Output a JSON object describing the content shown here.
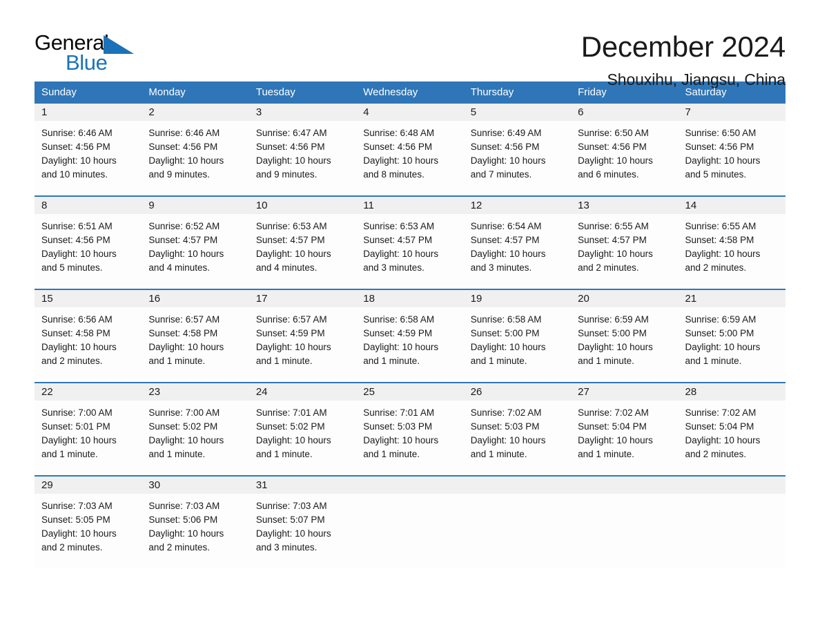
{
  "logo": {
    "word_one": "General",
    "word_two": "Blue",
    "triangle_icon": "triangle-icon",
    "accent_color": "#1b72b8"
  },
  "header": {
    "title": "December 2024",
    "subtitle": "Shouxihu, Jiangsu, China"
  },
  "calendar": {
    "header_bg_color": "#2f76b8",
    "date_band_color": "#f0f0f0",
    "weekdays": [
      "Sunday",
      "Monday",
      "Tuesday",
      "Wednesday",
      "Thursday",
      "Friday",
      "Saturday"
    ],
    "weeks": [
      [
        {
          "date": "1",
          "sunrise": "Sunrise: 6:46 AM",
          "sunset": "Sunset: 4:56 PM",
          "daylight_line1": "Daylight: 10 hours",
          "daylight_line2": "and 10 minutes."
        },
        {
          "date": "2",
          "sunrise": "Sunrise: 6:46 AM",
          "sunset": "Sunset: 4:56 PM",
          "daylight_line1": "Daylight: 10 hours",
          "daylight_line2": "and 9 minutes."
        },
        {
          "date": "3",
          "sunrise": "Sunrise: 6:47 AM",
          "sunset": "Sunset: 4:56 PM",
          "daylight_line1": "Daylight: 10 hours",
          "daylight_line2": "and 9 minutes."
        },
        {
          "date": "4",
          "sunrise": "Sunrise: 6:48 AM",
          "sunset": "Sunset: 4:56 PM",
          "daylight_line1": "Daylight: 10 hours",
          "daylight_line2": "and 8 minutes."
        },
        {
          "date": "5",
          "sunrise": "Sunrise: 6:49 AM",
          "sunset": "Sunset: 4:56 PM",
          "daylight_line1": "Daylight: 10 hours",
          "daylight_line2": "and 7 minutes."
        },
        {
          "date": "6",
          "sunrise": "Sunrise: 6:50 AM",
          "sunset": "Sunset: 4:56 PM",
          "daylight_line1": "Daylight: 10 hours",
          "daylight_line2": "and 6 minutes."
        },
        {
          "date": "7",
          "sunrise": "Sunrise: 6:50 AM",
          "sunset": "Sunset: 4:56 PM",
          "daylight_line1": "Daylight: 10 hours",
          "daylight_line2": "and 5 minutes."
        }
      ],
      [
        {
          "date": "8",
          "sunrise": "Sunrise: 6:51 AM",
          "sunset": "Sunset: 4:56 PM",
          "daylight_line1": "Daylight: 10 hours",
          "daylight_line2": "and 5 minutes."
        },
        {
          "date": "9",
          "sunrise": "Sunrise: 6:52 AM",
          "sunset": "Sunset: 4:57 PM",
          "daylight_line1": "Daylight: 10 hours",
          "daylight_line2": "and 4 minutes."
        },
        {
          "date": "10",
          "sunrise": "Sunrise: 6:53 AM",
          "sunset": "Sunset: 4:57 PM",
          "daylight_line1": "Daylight: 10 hours",
          "daylight_line2": "and 4 minutes."
        },
        {
          "date": "11",
          "sunrise": "Sunrise: 6:53 AM",
          "sunset": "Sunset: 4:57 PM",
          "daylight_line1": "Daylight: 10 hours",
          "daylight_line2": "and 3 minutes."
        },
        {
          "date": "12",
          "sunrise": "Sunrise: 6:54 AM",
          "sunset": "Sunset: 4:57 PM",
          "daylight_line1": "Daylight: 10 hours",
          "daylight_line2": "and 3 minutes."
        },
        {
          "date": "13",
          "sunrise": "Sunrise: 6:55 AM",
          "sunset": "Sunset: 4:57 PM",
          "daylight_line1": "Daylight: 10 hours",
          "daylight_line2": "and 2 minutes."
        },
        {
          "date": "14",
          "sunrise": "Sunrise: 6:55 AM",
          "sunset": "Sunset: 4:58 PM",
          "daylight_line1": "Daylight: 10 hours",
          "daylight_line2": "and 2 minutes."
        }
      ],
      [
        {
          "date": "15",
          "sunrise": "Sunrise: 6:56 AM",
          "sunset": "Sunset: 4:58 PM",
          "daylight_line1": "Daylight: 10 hours",
          "daylight_line2": "and 2 minutes."
        },
        {
          "date": "16",
          "sunrise": "Sunrise: 6:57 AM",
          "sunset": "Sunset: 4:58 PM",
          "daylight_line1": "Daylight: 10 hours",
          "daylight_line2": "and 1 minute."
        },
        {
          "date": "17",
          "sunrise": "Sunrise: 6:57 AM",
          "sunset": "Sunset: 4:59 PM",
          "daylight_line1": "Daylight: 10 hours",
          "daylight_line2": "and 1 minute."
        },
        {
          "date": "18",
          "sunrise": "Sunrise: 6:58 AM",
          "sunset": "Sunset: 4:59 PM",
          "daylight_line1": "Daylight: 10 hours",
          "daylight_line2": "and 1 minute."
        },
        {
          "date": "19",
          "sunrise": "Sunrise: 6:58 AM",
          "sunset": "Sunset: 5:00 PM",
          "daylight_line1": "Daylight: 10 hours",
          "daylight_line2": "and 1 minute."
        },
        {
          "date": "20",
          "sunrise": "Sunrise: 6:59 AM",
          "sunset": "Sunset: 5:00 PM",
          "daylight_line1": "Daylight: 10 hours",
          "daylight_line2": "and 1 minute."
        },
        {
          "date": "21",
          "sunrise": "Sunrise: 6:59 AM",
          "sunset": "Sunset: 5:00 PM",
          "daylight_line1": "Daylight: 10 hours",
          "daylight_line2": "and 1 minute."
        }
      ],
      [
        {
          "date": "22",
          "sunrise": "Sunrise: 7:00 AM",
          "sunset": "Sunset: 5:01 PM",
          "daylight_line1": "Daylight: 10 hours",
          "daylight_line2": "and 1 minute."
        },
        {
          "date": "23",
          "sunrise": "Sunrise: 7:00 AM",
          "sunset": "Sunset: 5:02 PM",
          "daylight_line1": "Daylight: 10 hours",
          "daylight_line2": "and 1 minute."
        },
        {
          "date": "24",
          "sunrise": "Sunrise: 7:01 AM",
          "sunset": "Sunset: 5:02 PM",
          "daylight_line1": "Daylight: 10 hours",
          "daylight_line2": "and 1 minute."
        },
        {
          "date": "25",
          "sunrise": "Sunrise: 7:01 AM",
          "sunset": "Sunset: 5:03 PM",
          "daylight_line1": "Daylight: 10 hours",
          "daylight_line2": "and 1 minute."
        },
        {
          "date": "26",
          "sunrise": "Sunrise: 7:02 AM",
          "sunset": "Sunset: 5:03 PM",
          "daylight_line1": "Daylight: 10 hours",
          "daylight_line2": "and 1 minute."
        },
        {
          "date": "27",
          "sunrise": "Sunrise: 7:02 AM",
          "sunset": "Sunset: 5:04 PM",
          "daylight_line1": "Daylight: 10 hours",
          "daylight_line2": "and 1 minute."
        },
        {
          "date": "28",
          "sunrise": "Sunrise: 7:02 AM",
          "sunset": "Sunset: 5:04 PM",
          "daylight_line1": "Daylight: 10 hours",
          "daylight_line2": "and 2 minutes."
        }
      ],
      [
        {
          "date": "29",
          "sunrise": "Sunrise: 7:03 AM",
          "sunset": "Sunset: 5:05 PM",
          "daylight_line1": "Daylight: 10 hours",
          "daylight_line2": "and 2 minutes."
        },
        {
          "date": "30",
          "sunrise": "Sunrise: 7:03 AM",
          "sunset": "Sunset: 5:06 PM",
          "daylight_line1": "Daylight: 10 hours",
          "daylight_line2": "and 2 minutes."
        },
        {
          "date": "31",
          "sunrise": "Sunrise: 7:03 AM",
          "sunset": "Sunset: 5:07 PM",
          "daylight_line1": "Daylight: 10 hours",
          "daylight_line2": "and 3 minutes."
        },
        {
          "date": "",
          "sunrise": "",
          "sunset": "",
          "daylight_line1": "",
          "daylight_line2": ""
        },
        {
          "date": "",
          "sunrise": "",
          "sunset": "",
          "daylight_line1": "",
          "daylight_line2": ""
        },
        {
          "date": "",
          "sunrise": "",
          "sunset": "",
          "daylight_line1": "",
          "daylight_line2": ""
        },
        {
          "date": "",
          "sunrise": "",
          "sunset": "",
          "daylight_line1": "",
          "daylight_line2": ""
        }
      ]
    ]
  }
}
